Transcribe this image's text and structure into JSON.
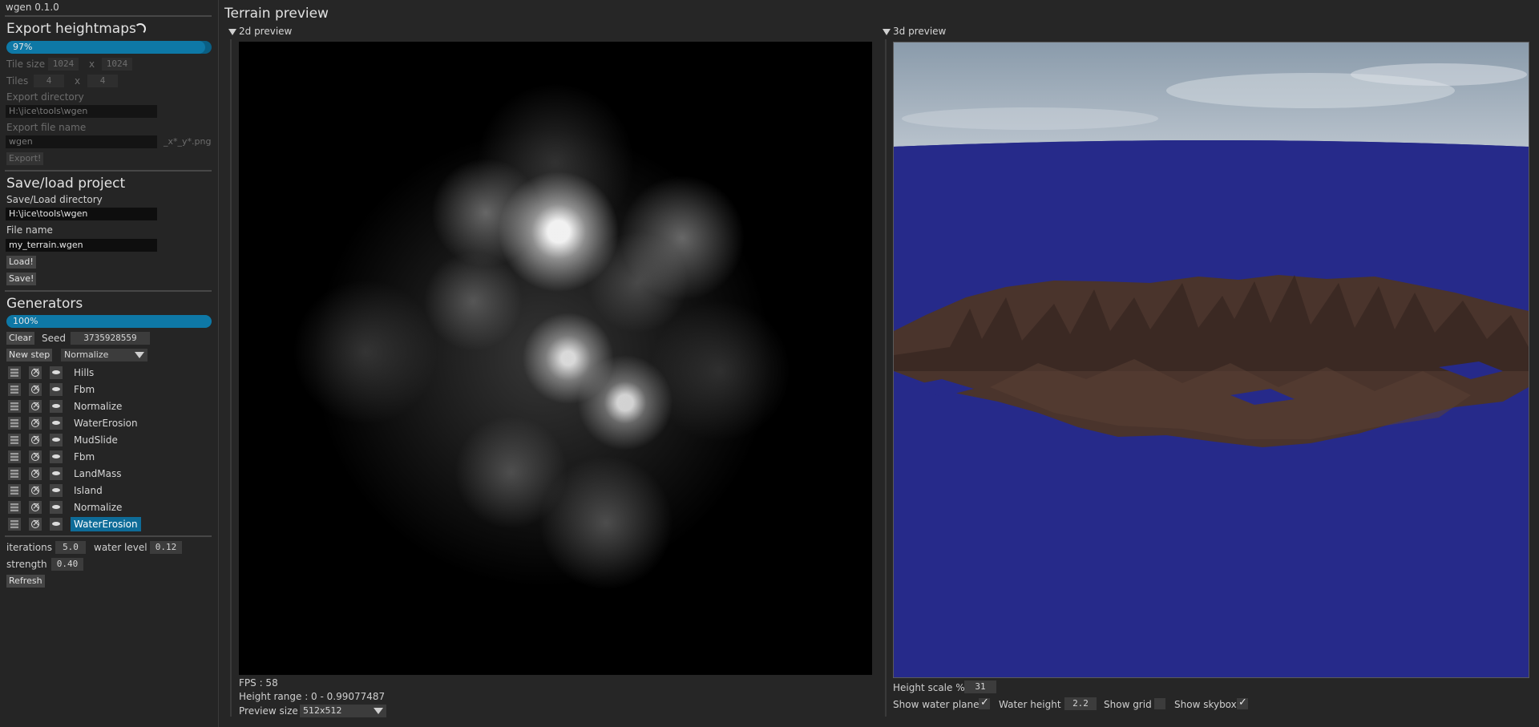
{
  "app": {
    "title": "wgen 0.1.0"
  },
  "export": {
    "heading": "Export heightmaps",
    "progress_value": 0.97,
    "progress_text": "97%",
    "tile_size_label": "Tile size",
    "tile_size_w": "1024",
    "tile_size_x": "x",
    "tile_size_h": "1024",
    "tiles_label": "Tiles",
    "tiles_w": "4",
    "tiles_x": "x",
    "tiles_h": "4",
    "dir_label": "Export directory",
    "dir_value": "H:\\jice\\tools\\wgen",
    "file_label": "Export file name",
    "file_value": "wgen",
    "file_suffix": "_x*_y*.png",
    "export_button": "Export!"
  },
  "project": {
    "heading": "Save/load project",
    "dir_label": "Save/Load directory",
    "dir_value": "H:\\jice\\tools\\wgen",
    "file_label": "File name",
    "file_value": "my_terrain.wgen",
    "load_button": "Load!",
    "save_button": "Save!"
  },
  "generators": {
    "heading": "Generators",
    "progress_value": 1.0,
    "progress_text": "100%",
    "clear_button": "Clear",
    "seed_label": "Seed",
    "seed_value": "3735928559",
    "new_step_button": "New step",
    "new_step_type": "Normalize",
    "steps": [
      {
        "name": "Hills"
      },
      {
        "name": "Fbm"
      },
      {
        "name": "Normalize"
      },
      {
        "name": "WaterErosion"
      },
      {
        "name": "MudSlide"
      },
      {
        "name": "Fbm"
      },
      {
        "name": "LandMass"
      },
      {
        "name": "Island"
      },
      {
        "name": "Normalize"
      },
      {
        "name": "WaterErosion",
        "selected": true
      }
    ],
    "params": {
      "iterations_label": "iterations",
      "iterations_value": "5.0",
      "water_level_label": "water level",
      "water_level_value": "0.12",
      "strength_label": "strength",
      "strength_value": "0.40",
      "refresh_button": "Refresh"
    }
  },
  "preview": {
    "title": "Terrain preview",
    "panel2d": {
      "header": "2d preview",
      "fps": "FPS : 58",
      "height_range": "Height range : 0 - 0.99077487",
      "preview_size_label": "Preview size",
      "preview_size_value": "512x512"
    },
    "panel3d": {
      "header": "3d preview",
      "height_scale_label": "Height scale %",
      "height_scale_value": "31",
      "show_water_label": "Show water plane",
      "show_water": true,
      "water_height_label": "Water height",
      "water_height_value": "2.2",
      "show_grid_label": "Show grid",
      "show_grid": false,
      "show_skybox_label": "Show skybox",
      "show_skybox": true
    }
  },
  "colors": {
    "accent": "#0e78a6",
    "water": "#262b8c",
    "terrain": "#4a342c",
    "sky": "#9fb0bf"
  }
}
